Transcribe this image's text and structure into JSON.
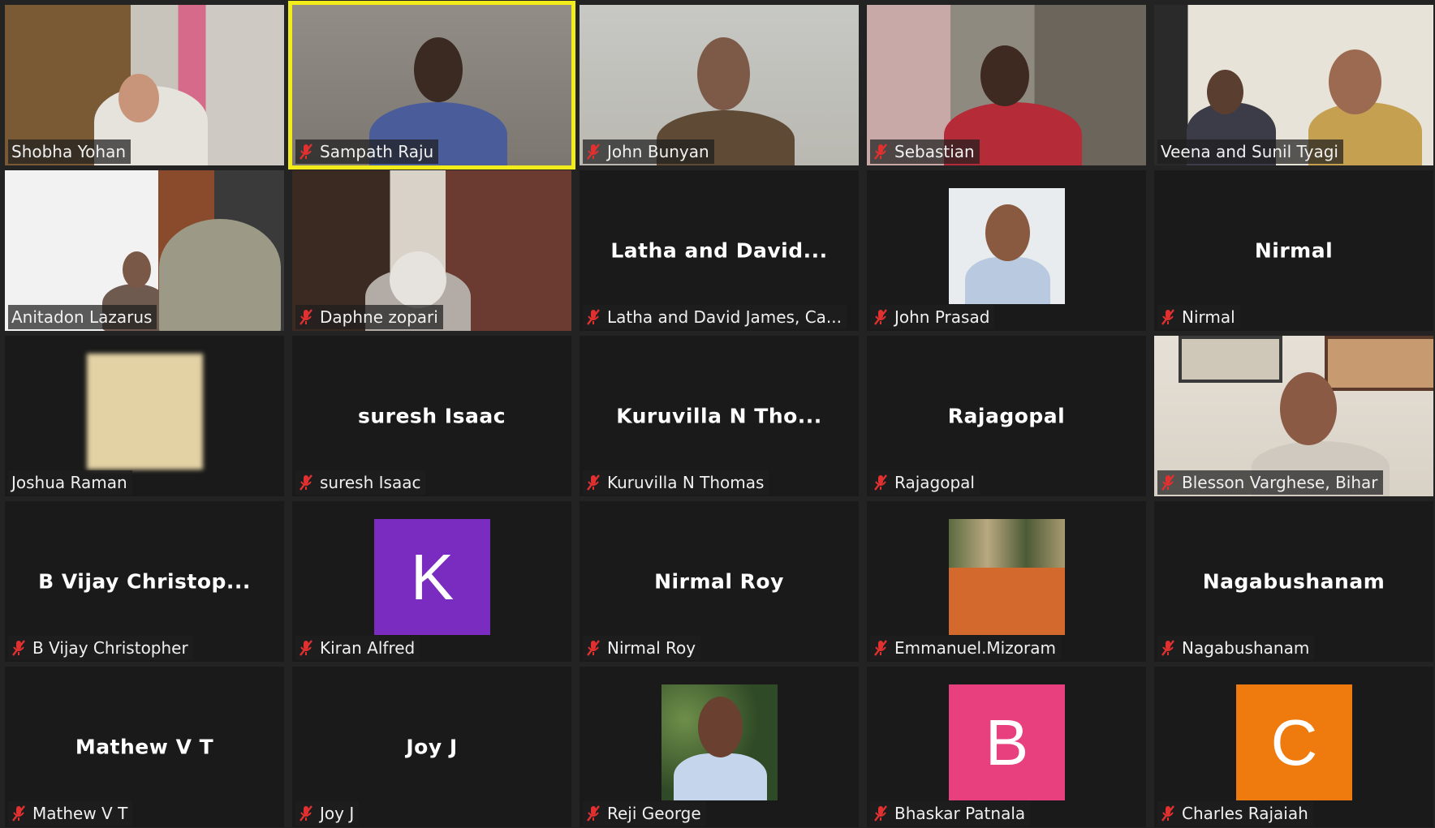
{
  "colors": {
    "active_speaker_outline": "#f2ec1a",
    "pinned_outline": "#c9e86a",
    "muted_icon": "#e03030",
    "tile_background": "#1a1a1a"
  },
  "participants": [
    {
      "label": "Shobha Yohan",
      "muted": false,
      "kind": "video"
    },
    {
      "label": "Sampath Raju",
      "muted": true,
      "kind": "video",
      "active_speaker": true
    },
    {
      "label": "John Bunyan",
      "muted": true,
      "kind": "video"
    },
    {
      "label": "Sebastian",
      "muted": true,
      "kind": "video"
    },
    {
      "label": "Veena and Sunil Tyagi",
      "muted": false,
      "kind": "video",
      "pinned": true
    },
    {
      "label": "Anitadon Lazarus",
      "muted": false,
      "kind": "video"
    },
    {
      "label": "Daphne zopari",
      "muted": true,
      "kind": "video"
    },
    {
      "label": "Latha and David James, Ca...",
      "display": "Latha and David...",
      "muted": true,
      "kind": "name"
    },
    {
      "label": "John Prasad",
      "muted": true,
      "kind": "photo"
    },
    {
      "label": "Nirmal",
      "display": "Nirmal",
      "muted": true,
      "kind": "name"
    },
    {
      "label": "Joshua Raman",
      "muted": false,
      "kind": "photo-blur"
    },
    {
      "label": "suresh Isaac",
      "display": "suresh Isaac",
      "muted": true,
      "kind": "name"
    },
    {
      "label": "Kuruvilla N Thomas",
      "display": "Kuruvilla N Tho...",
      "muted": true,
      "kind": "name"
    },
    {
      "label": "Rajagopal",
      "display": "Rajagopal",
      "muted": true,
      "kind": "name"
    },
    {
      "label": "Blesson Varghese, Bihar",
      "muted": true,
      "kind": "video"
    },
    {
      "label": "B Vijay Christopher",
      "display": "B Vijay Christop...",
      "muted": true,
      "kind": "name"
    },
    {
      "label": "Kiran Alfred",
      "muted": true,
      "kind": "letter",
      "letter": "K",
      "avatar_color": "#7b2cc0"
    },
    {
      "label": "Nirmal Roy",
      "display": "Nirmal Roy",
      "muted": true,
      "kind": "name"
    },
    {
      "label": "Emmanuel.Mizoram",
      "muted": true,
      "kind": "photo-book"
    },
    {
      "label": "Nagabushanam",
      "display": "Nagabushanam",
      "muted": true,
      "kind": "name"
    },
    {
      "label": "Mathew V T",
      "display": "Mathew V T",
      "muted": true,
      "kind": "name"
    },
    {
      "label": "Joy J",
      "display": "Joy J",
      "muted": true,
      "kind": "name"
    },
    {
      "label": "Reji George",
      "muted": true,
      "kind": "photo-outdoor"
    },
    {
      "label": "Bhaskar Patnala",
      "muted": true,
      "kind": "letter",
      "letter": "B",
      "avatar_color": "#e8407f"
    },
    {
      "label": "Charles Rajaiah",
      "muted": true,
      "kind": "letter",
      "letter": "C",
      "avatar_color": "#ef7a0d"
    }
  ]
}
